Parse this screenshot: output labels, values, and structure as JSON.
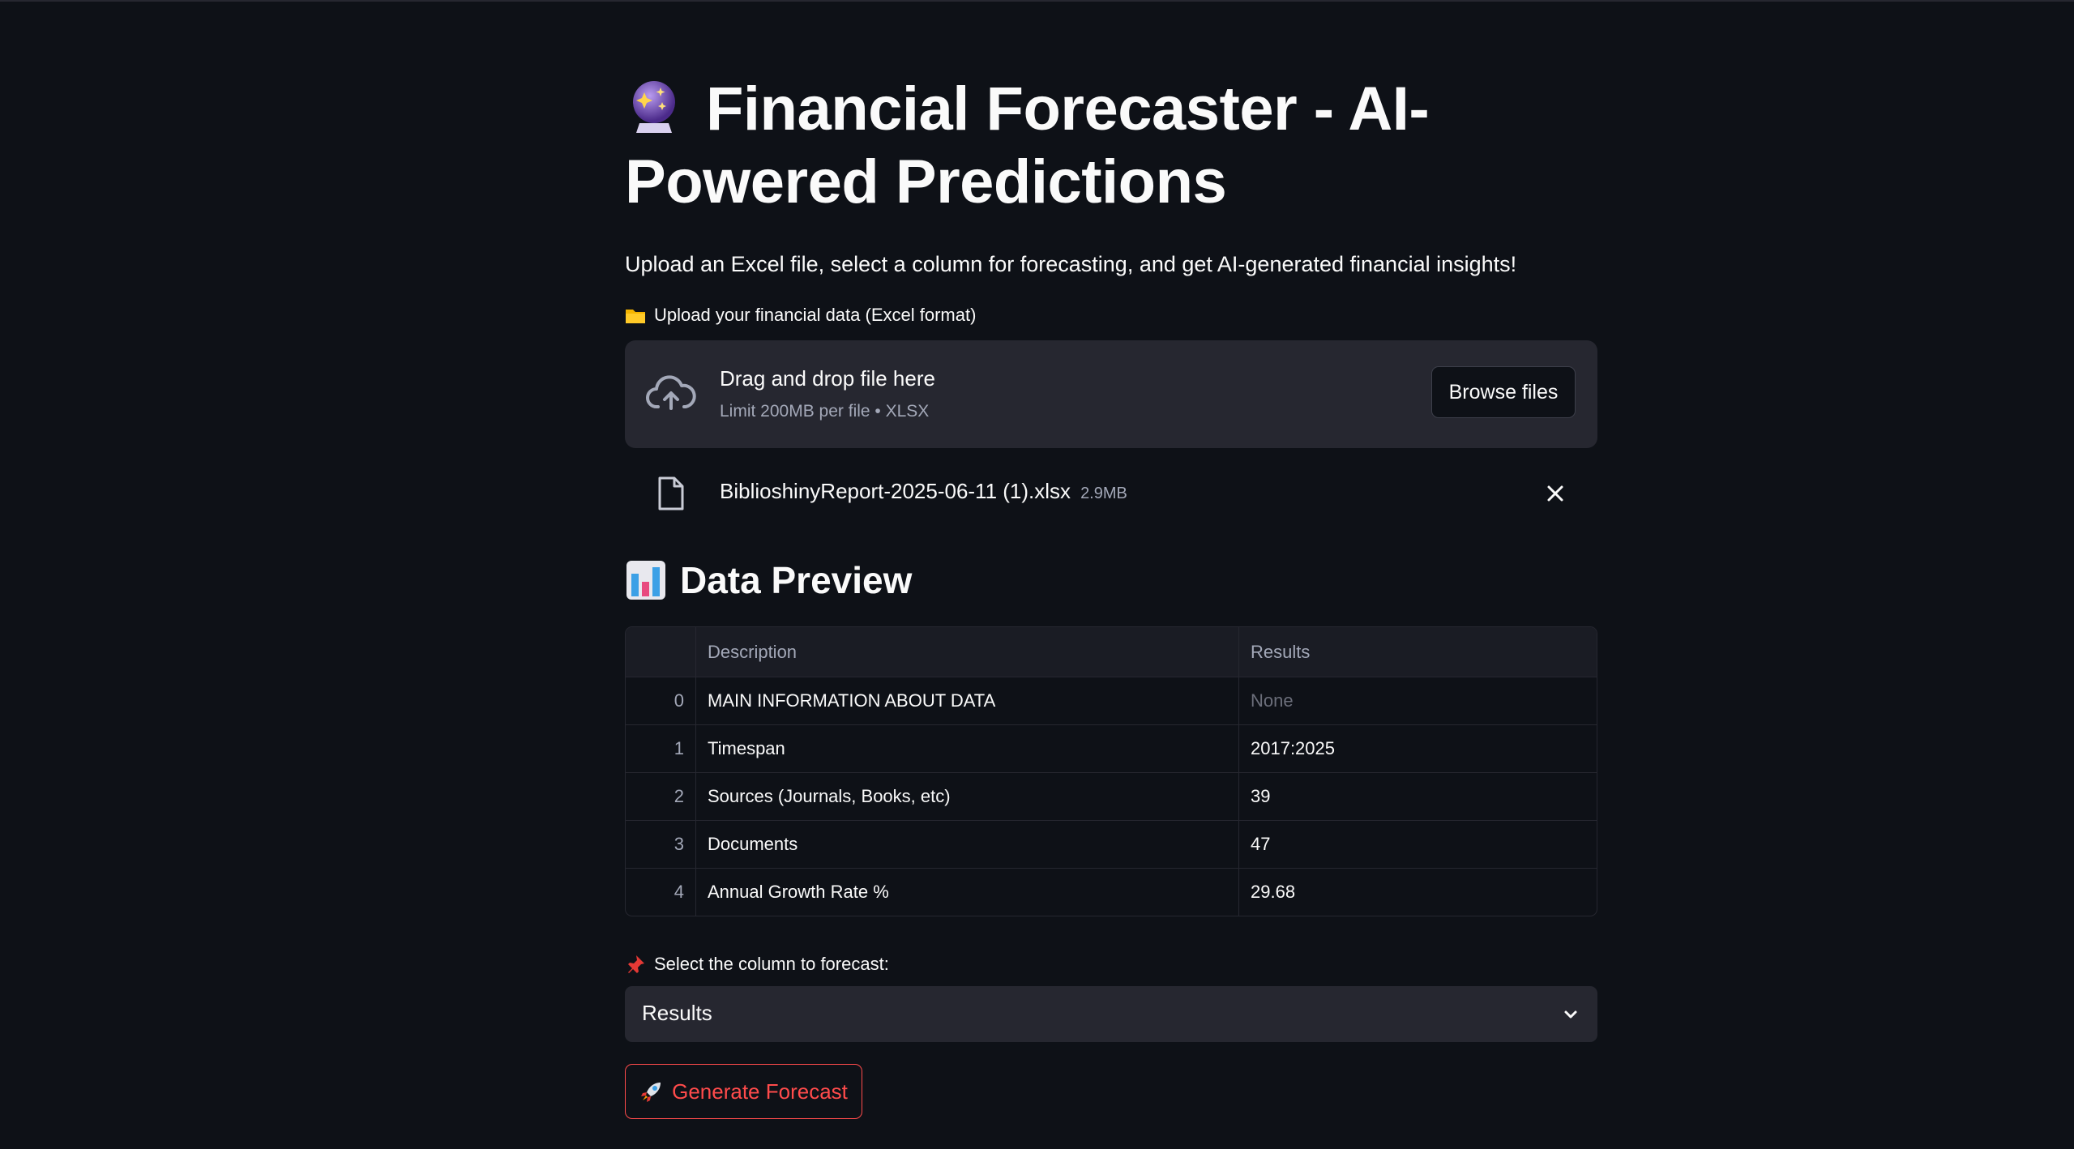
{
  "header": {
    "title": "Financial Forecaster - AI-Powered Predictions",
    "title_icon": "crystal-ball-icon",
    "subtitle": "Upload an Excel file, select a column for forecasting, and get AI-generated financial insights!"
  },
  "uploader": {
    "label": "Upload your financial data (Excel format)",
    "label_icon": "folder-icon",
    "dropzone_title": "Drag and drop file here",
    "dropzone_limit": "Limit 200MB per file • XLSX",
    "browse_label": "Browse files",
    "file": {
      "name": "BiblioshinyReport-2025-06-11 (1).xlsx",
      "size": "2.9MB"
    }
  },
  "preview": {
    "heading": "Data Preview",
    "heading_icon": "bar-chart-icon",
    "columns": [
      "",
      "Description",
      "Results"
    ],
    "rows": [
      {
        "index": "0",
        "description": "MAIN INFORMATION ABOUT DATA",
        "results": "None"
      },
      {
        "index": "1",
        "description": "Timespan",
        "results": "2017:2025"
      },
      {
        "index": "2",
        "description": "Sources (Journals, Books, etc)",
        "results": "39"
      },
      {
        "index": "3",
        "description": "Documents",
        "results": "47"
      },
      {
        "index": "4",
        "description": "Annual Growth Rate %",
        "results": "29.68"
      }
    ]
  },
  "forecast": {
    "select_label": "Select the column to forecast:",
    "select_icon": "pushpin-icon",
    "selected_value": "Results",
    "button_label": "Generate Forecast",
    "button_icon": "rocket-icon"
  },
  "colors": {
    "background": "#0e1117",
    "surface": "#262730",
    "accent": "#ff4b4b",
    "muted_text": "#a3a8b8"
  }
}
